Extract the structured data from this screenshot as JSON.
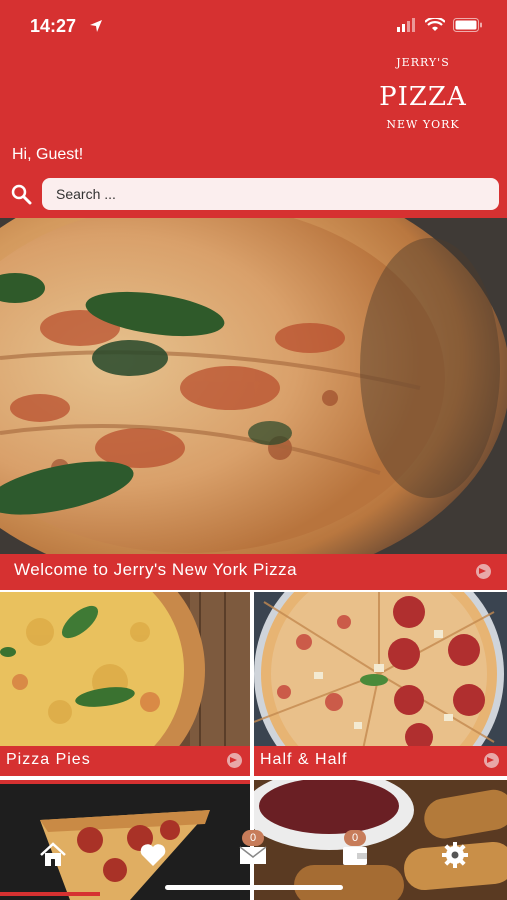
{
  "status_bar": {
    "time": "14:27"
  },
  "logo": {
    "top": "JERRY'S",
    "main": "PIZZA",
    "bottom": "NEW YORK"
  },
  "greeting": "Hi, Guest!",
  "search": {
    "placeholder": "Search ..."
  },
  "hero": {
    "title": "Welcome to Jerry's New York Pizza"
  },
  "categories": [
    {
      "label": "Pizza Pies"
    },
    {
      "label": "Half & Half"
    }
  ],
  "nav": {
    "items": [
      {
        "icon": "home-icon"
      },
      {
        "icon": "heart-icon"
      },
      {
        "icon": "mail-icon",
        "badge": "0"
      },
      {
        "icon": "wallet-icon",
        "badge": "0"
      },
      {
        "icon": "gear-icon"
      }
    ]
  },
  "colors": {
    "brand": "#d63131"
  }
}
